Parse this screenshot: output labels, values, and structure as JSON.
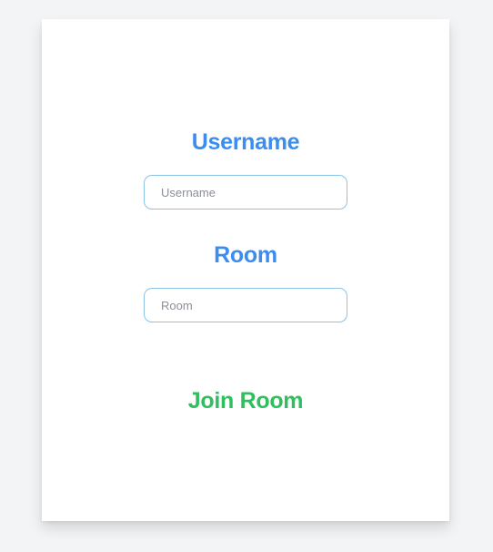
{
  "form": {
    "username_label": "Username",
    "username_placeholder": "Username",
    "username_value": "",
    "room_label": "Room",
    "room_placeholder": "Room",
    "room_value": "",
    "join_label": "Join Room"
  },
  "colors": {
    "background": "#f3f4f6",
    "card": "#ffffff",
    "heading": "#3b8def",
    "input_border": "#8cc4e8",
    "join": "#2fbf5e"
  }
}
